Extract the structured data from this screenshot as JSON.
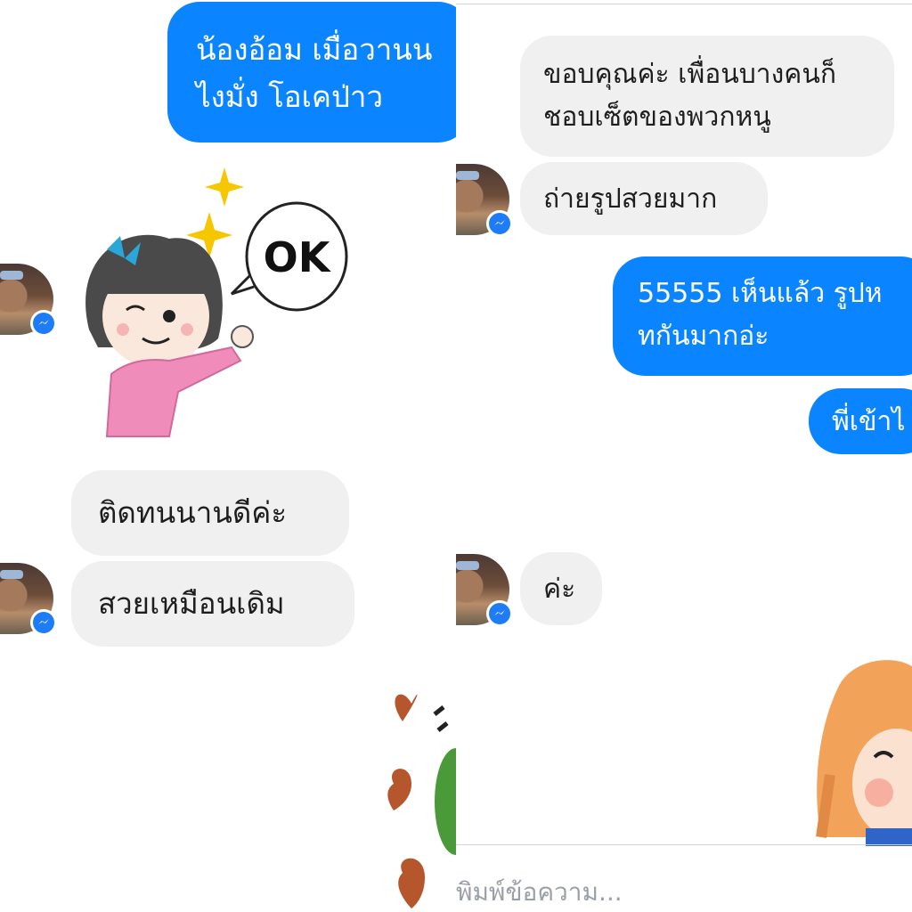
{
  "left_panel": {
    "outgoing_message": "น้องอ้อม เมื่อวานน\nไงมั่ง โอเคป่าว",
    "sticker_text": "OK",
    "incoming_messages": [
      "ติดทนนานดีค่ะ",
      "สวยเหมือนเดิม"
    ]
  },
  "right_panel": {
    "incoming_messages": [
      "ขอบคุณค่ะ เพื่อนบางคนก็\nชอบเซ็ตของพวกหนู",
      "ถ่ายรูปสวยมาก"
    ],
    "outgoing_messages": [
      "55555 เห็นแล้ว รูปห\nทกันมากอ่ะ",
      "พี่เข้าไ"
    ],
    "last_incoming": "ค่ะ",
    "input_placeholder": "พิมพ์ข้อความ..."
  },
  "colors": {
    "outgoing_bubble": "#0b84ff",
    "incoming_bubble": "#f0f0f0",
    "messenger_badge": "#1f7cf7"
  },
  "icons": [
    "messenger-badge-icon",
    "sparkle-icon",
    "heart-icon"
  ]
}
